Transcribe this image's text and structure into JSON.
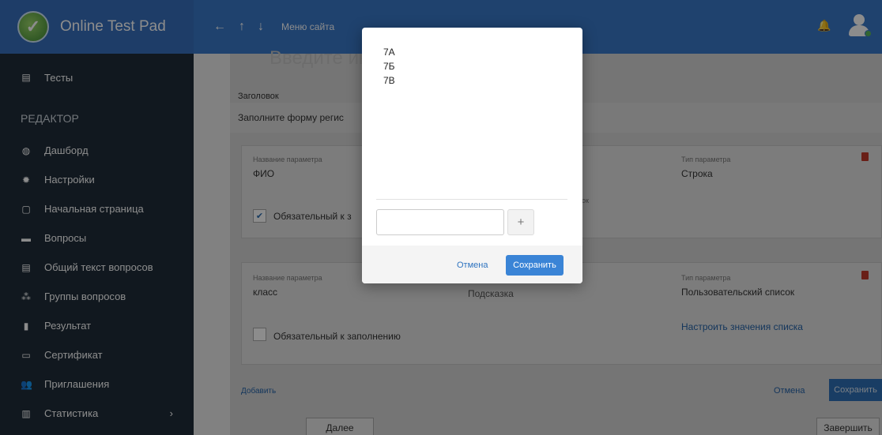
{
  "topbar": {
    "app_title": "Online Test Pad",
    "back_arrow": "←",
    "up_arrow": "↑",
    "down_arrow": "↓",
    "site_menu": "Меню сайта"
  },
  "sidebar": {
    "items_top": [
      {
        "label": "Тесты",
        "icon": "test-icon"
      }
    ],
    "section_label": "РЕДАКТОР",
    "items": [
      {
        "label": "Дашборд",
        "icon": "dashboard-icon"
      },
      {
        "label": "Настройки",
        "icon": "gear-icon"
      },
      {
        "label": "Начальная страница",
        "icon": "page-icon"
      },
      {
        "label": "Вопросы",
        "icon": "questions-icon"
      },
      {
        "label": "Общий текст вопросов",
        "icon": "text-icon"
      },
      {
        "label": "Группы вопросов",
        "icon": "groups-icon"
      },
      {
        "label": "Результат",
        "icon": "result-icon"
      },
      {
        "label": "Сертификат",
        "icon": "certificate-icon"
      },
      {
        "label": "Приглашения",
        "icon": "invite-icon"
      },
      {
        "label": "Статистика",
        "icon": "stats-icon"
      }
    ],
    "stats_chevron": "›"
  },
  "main": {
    "ghost_title": "Введите инс",
    "heading_label": "Заголовок",
    "heading_value": "Заполните форму регис",
    "param1": {
      "name_label": "Название параметра",
      "name_value": "ФИО",
      "type_label": "Тип параметра",
      "type_value": "Строка",
      "hint_fragment": "ок",
      "required_label": "Обязательный к з",
      "required_checked": true
    },
    "param2": {
      "name_label": "Название параметра",
      "name_value": "класс",
      "hint_value": "Подсказка",
      "type_label": "Тип параметра",
      "type_value": "Пользовательский список",
      "required_label": "Обязательный к заполнению",
      "required_checked": false,
      "configure_link": "Настроить значения списка"
    },
    "add_link": "Добавить",
    "cancel_link": "Отмена",
    "save_button": "Сохранить",
    "next_button": "Далее",
    "finish_button": "Завершить"
  },
  "modal": {
    "list_items": [
      "7А",
      "7Б",
      "7В"
    ],
    "input_value": "",
    "plus_label": "+",
    "cancel_label": "Отмена",
    "save_label": "Сохранить"
  },
  "colors": {
    "topbar": "#3a78c9",
    "sidebar": "#1f2d3a",
    "accent": "#3a84d6",
    "danger": "#c0392b"
  }
}
